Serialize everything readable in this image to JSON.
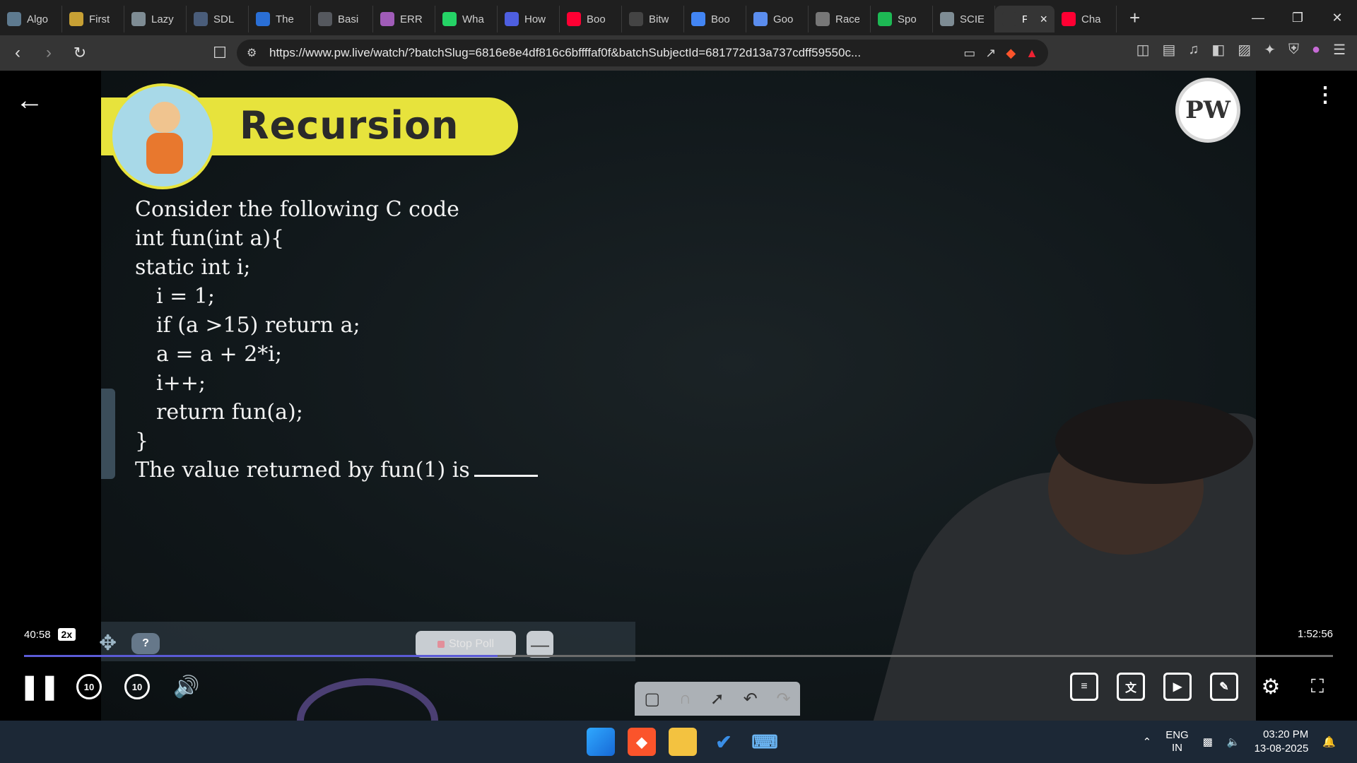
{
  "browser": {
    "tabs": [
      {
        "label": "Algo",
        "icon": "chat-bubble-icon",
        "color": "#5e7a8f"
      },
      {
        "label": "First",
        "icon": "bolt-icon",
        "color": "#c7a034"
      },
      {
        "label": "Lazy",
        "icon": "globe-icon",
        "color": "#7e8c94"
      },
      {
        "label": "SDL",
        "icon": "page-icon",
        "color": "#4a5d7a"
      },
      {
        "label": "The",
        "icon": "w3-icon",
        "color": "#2a6fd6"
      },
      {
        "label": "Basi",
        "icon": "code-icon",
        "color": "#55585e"
      },
      {
        "label": "ERR",
        "icon": "brain-icon",
        "color": "#a05cb8"
      },
      {
        "label": "Wha",
        "icon": "whatsapp-icon",
        "color": "#25d366"
      },
      {
        "label": "How",
        "icon": "bookmark-icon",
        "color": "#4e5fe0"
      },
      {
        "label": "Boo",
        "icon": "youtube-icon",
        "color": "#ff0033"
      },
      {
        "label": "Bitw",
        "icon": "gfg-icon",
        "color": "#444444"
      },
      {
        "label": "Boo",
        "icon": "google-icon",
        "color": "#4285f4"
      },
      {
        "label": "Goo",
        "icon": "gemini-icon",
        "color": "#5b8dee"
      },
      {
        "label": "Race",
        "icon": "openai-icon",
        "color": "#777777"
      },
      {
        "label": "Spo",
        "icon": "spotify-icon",
        "color": "#1db954"
      },
      {
        "label": "SCIE",
        "icon": "globe-icon",
        "color": "#7e8c94"
      },
      {
        "label": "P",
        "icon": "speaker-icon",
        "color": "#353535",
        "active": true
      },
      {
        "label": "Cha",
        "icon": "youtube-icon",
        "color": "#ff0033"
      }
    ],
    "url": "https://www.pw.live/watch/?batchSlug=6816e8e4df816c6bffffaf0f&batchSubjectId=681772d13a737cdff59550c..."
  },
  "lecture": {
    "title": "Recursion",
    "logo_text": "PW",
    "question_lines": [
      "Consider the following C code",
      "int fun(int a){",
      "static int i;",
      "i = 1;",
      "if (a >15) return a;",
      "a = a + 2*i;",
      "i++;",
      "return fun(a);",
      "}",
      "The value returned by fun(1) is"
    ]
  },
  "player": {
    "current_time": "40:58",
    "speed": "2x",
    "total_time": "1:52:56",
    "progress_fraction": 0.362,
    "poll_help": "?",
    "stop_poll_label": "Stop Poll",
    "skip_back": "10",
    "skip_forward": "10"
  },
  "taskbar": {
    "lang_top": "ENG",
    "lang_bottom": "IN",
    "time": "03:20 PM",
    "date": "13-08-2025"
  }
}
